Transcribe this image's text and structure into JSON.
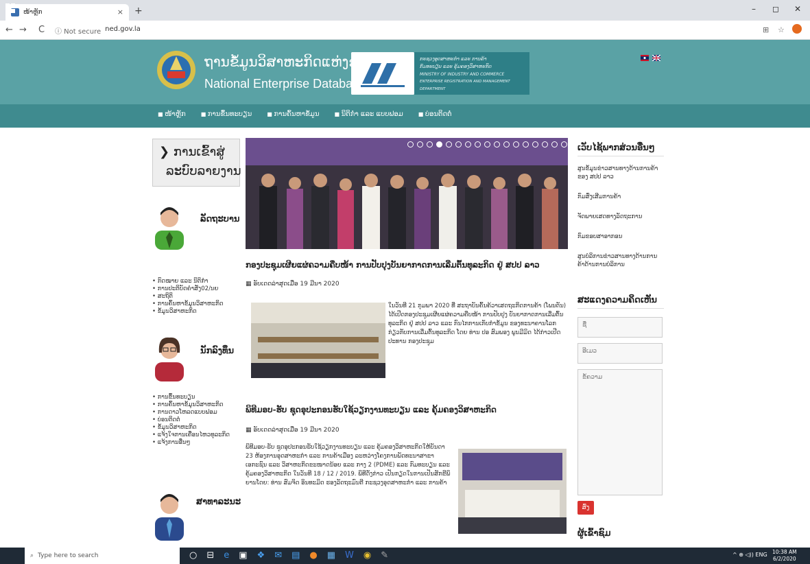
{
  "browser": {
    "tab_title": "ໜ້າຫຼັກ",
    "tab_close": "×",
    "new_tab": "+",
    "back": "←",
    "forward": "→",
    "reload": "C",
    "security": "ⓘ Not secure",
    "url": "ned.gov.la",
    "minimize": "–",
    "maximize": "◻",
    "close": "✕"
  },
  "header": {
    "title_lao": "ຖານຂໍ້ມູນວິສາຫະກິດແຫ່ງຊາດ",
    "title_en": "National Enterprise Database",
    "ministry_lines": [
      "ກະຊວງອຸດສາຫະກຳ ແລະ ການຄ້າ",
      "ກົມທະບຽນ ແລະ ຄຸ້ມຄອງວິສາຫະກິດ",
      "MINISTRY OF INDUSTRY AND COMMERCE",
      "ENTERPRISE REGISTRATION AND MANAGEMENT DEPARTMENT"
    ]
  },
  "menu": [
    "ໜ້າຫຼັກ",
    "ການຂຶ້ນທະບຽນ",
    "ການຄົ້ນຫາຂໍ້ມູນ",
    "ນິຕິກຳ ແລະ ແບບຟອມ",
    "ບ່ອນຕິດຕໍ່"
  ],
  "left": {
    "report_line1": "❯ ການເຂົ້າສູ່",
    "report_line2": "ລະບົບລາຍງານ",
    "government_label": "ລັດຖະບານ",
    "government_items": [
      "ກົດໝາຍ ແລະ ນິຕິກຳ",
      "ການປະຕິບັດຄຳສັ່ງ02/ນຍ",
      "ສະຖິຕິ",
      "ການຄົ້ນຫາຂໍ້ມູນວິສາຫະກິດ",
      "ຂໍ້ມູນວິສາຫະກິດ"
    ],
    "investor_label": "ນັກລົງທຶນ",
    "investor_items": [
      "ການຂຶ້ນທະບຽນ",
      "ການຄົ້ນຫາຂໍ້ມູນວິສາຫະກິດ",
      "ການດາວໂຫລດແບບຟອມ",
      "ບ່ອນຕິດຕໍ່",
      "ຂໍ້ມູນວິສາຫະກິດ",
      "ແຈ້ງໃຈການເຄື່ອນໄຫວທຸລະກິດ",
      "ແຈ້ງການອື່ນໆ"
    ],
    "public_label": "ສາທາລະນະ"
  },
  "articles": [
    {
      "title": "ກອງປະຊຸມເຜີຍແຜ່ຄວາມຄືບໜ້າ ການປັບປຸງບັນຍາກາດການເລີ່ມຕົ້ນທຸລະກິດ ຢູ່ ສປປ ລາວ",
      "date": "ອັບເດດລ່າສຸດເມື່ອ 19 ມີນາ 2020",
      "body": "ໃນວັນທີ 21 ກຸມພາ 2020 ທີ່ ສະຖາບັນຄົ້ນຄ້ວາເສດຖະກິດການຄ້າ (ໂພນຕັນ) ໄດ້ເປີດກອງປະຊຸມເຜີຍແຜ່ຄວາມຄືບໜ້າ ການປັບປຸງ ບັນຍາກາດການເລີ່ມຕົ້ນທຸລະກິດ ຢູ່ ສປປ ລາວ ແລະ ກົນໄກການເກັບກຳຂໍ້ມູນ ຂອງທະນາຄານໂລກ ກ່ຽວກັບການເລີ່ມຕົ້ນທຸລະກິດ ໂດຍ ທ່ານ ປອ ສົມພອງ ພູນມີມິດ ໄດ້ກ່າວເປີດປະທານ ກອງປະຊຸມ"
    },
    {
      "title": "ພິທີມອບ-ຮັບ ຊຸດອຸປະກອນຮັບໃຊ້ວຽກງານທະບຽນ ແລະ ຄຸ້ມຄອງວິສາຫະກິດ",
      "date": "ອັບເດດລ່າສຸດເມື່ອ 19 ມີນາ 2020",
      "body": "ພິທີມອບ-ຮັບ ຊຸດອຸປະກອນຮັບໃຊ້ວຽກງານທະບຽນ ແລະ ຄຸ້ມຄອງວິສາຫະກິດໃຫ້ບັນດາ 23 ຫ້ອງການອຸດສາຫະກຳ ແລະ ການຄ້າເມືອງ ລະຫວ່າງໂຄງການພັດທະນາສາຂາເອກະຊົນ ແລະ ວິສາຫະກິດຂະໜາດນ້ອຍ ແລະ ກາງ 2 (PDME) ແລະ ກົມທະບຽນ ແລະ ຄຸ້ມຄອງວິສາຫະກິດ ໃນວັນທີ 18 / 12 / 2019. ພິທີດັ່ງກ່າວ ເປັນກຽດໃນການເປັນສັກຂີພິຍານໂດຍ: ທ່ານ ສົມຈິດ ອິນທະມິດ ຮອງລັດຖະມົນຕີ ກະຊວງອຸດສາຫະກຳ ແລະ ການຄ້າ"
    }
  ],
  "right": {
    "links_head": "ເວັບໄຊ້ພາກສ່ວນອື່ນໆ",
    "links": [
      "ສູນຂໍ້ມູນຂ່າວສານທາງດ້ານການຄ້າ ຂອງ ສປປ ລາວ",
      "ກົມສົ່ງເສີມການຄ້າ",
      "ຈັດພາຍເສດທາງລັດຖະການ",
      "ກົມຂອບສາອາກອນ",
      "ສູນບໍລິການຂ່າວສານທາງດ້ານການຄ້າດ້ານການບໍລິການ"
    ],
    "comment_head": "ສະແດງຄວາມຄິດເຫັນ",
    "name_placeholder": "ຊື່",
    "email_placeholder": "ອີເມວ",
    "message_placeholder": "ຂໍ້ຄວາມ",
    "send_label": "ສົ່ງ",
    "visitors_head": "ຜູ້ເຂົ້າຊົມ"
  },
  "taskbar": {
    "search_placeholder": "Type here to search",
    "tray": "^ ⊕ ◁)) ENG",
    "time": "10:38 AM",
    "date": "6/2/2020"
  },
  "colors": {
    "header_bg": "#5aa2a5",
    "menu_bg": "#3f8b8f",
    "send_btn": "#d9332f"
  }
}
